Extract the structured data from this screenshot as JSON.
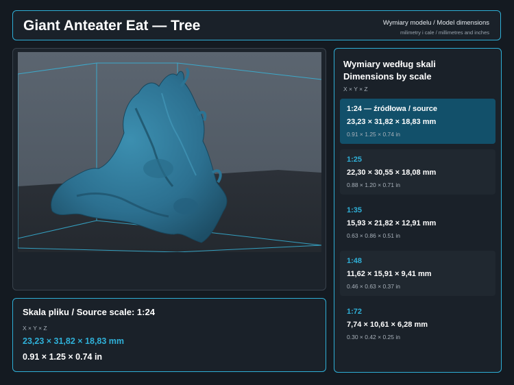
{
  "header": {
    "title": "Giant Anteater Eat — Tree",
    "subtitle": "Wymiary modelu / Model dimensions",
    "units_note": "milimetry i cale / millimetres and inches"
  },
  "viewport": {
    "object": "3D model render"
  },
  "source_scale": {
    "title": "Skala pliku / Source scale: 1:24",
    "axes": "X × Y × Z",
    "mm": "23,23 × 31,82 × 18,83 mm",
    "inches": "0.91 × 1.25 × 0.74 in"
  },
  "scales_panel": {
    "title_pl": "Wymiary według skali",
    "title_en": "Dimensions by scale",
    "axes": "X × Y × Z",
    "items": [
      {
        "scale": "1:24  —  źródłowa / source",
        "mm": "23,23 × 31,82 × 18,83 mm",
        "inches": "0.91 × 1.25 × 0.74 in"
      },
      {
        "scale": "1:25",
        "mm": "22,30 × 30,55 × 18,08 mm",
        "inches": "0.88 × 1.20 × 0.71 in"
      },
      {
        "scale": "1:35",
        "mm": "15,93 × 21,82 × 12,91 mm",
        "inches": "0.63 × 0.86 × 0.51 in"
      },
      {
        "scale": "1:48",
        "mm": "11,62 × 15,91 × 9,41 mm",
        "inches": "0.46 × 0.63 × 0.37 in"
      },
      {
        "scale": "1:72",
        "mm": "7,74 × 10,61 × 6,28 mm",
        "inches": "0.30 × 0.42 × 0.25 in"
      }
    ]
  },
  "colors": {
    "accent": "#2fb0d8",
    "background": "#141a21",
    "panel": "#1a2129",
    "selected": "#12506a",
    "model": "#2f7d9c"
  }
}
